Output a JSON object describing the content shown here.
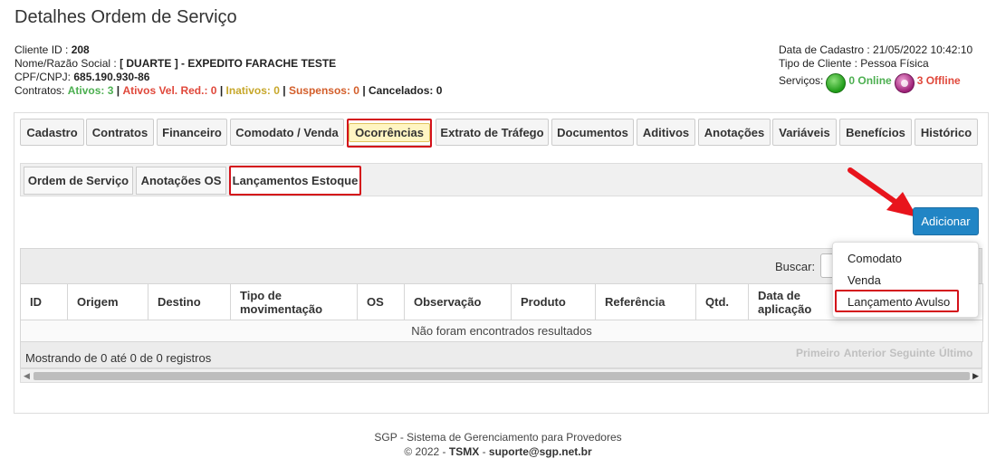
{
  "page": {
    "title": "Detalhes Ordem de Serviço"
  },
  "client": {
    "id_label": "Cliente ID :",
    "id_value": "208",
    "name_label": "Nome/Razão Social :",
    "name_value": "[ DUARTE ] - EXPEDITO FARACHE TESTE",
    "doc_label": "CPF/CNPJ:",
    "doc_value": "685.190.930-86",
    "contracts_label": "Contratos:",
    "contracts": {
      "ativos": "Ativos: 3",
      "ativos_vel": "Ativos Vel. Red.: 0",
      "inativos": "Inativos: 0",
      "suspensos": "Suspensos: 0",
      "cancelados": "Cancelados: 0",
      "sep": "|"
    }
  },
  "meta": {
    "cadastro": "Data de Cadastro : 21/05/2022 10:42:10",
    "tipo": "Tipo de Cliente : Pessoa Física",
    "servicos_label": "Serviços:",
    "online": "0 Online",
    "offline": "3 Offline"
  },
  "tabs": [
    "Cadastro",
    "Contratos",
    "Financeiro",
    "Comodato / Venda",
    "Ocorrências",
    "Extrato de Tráfego",
    "Documentos",
    "Aditivos",
    "Anotações",
    "Variáveis",
    "Benefícios",
    "Histórico"
  ],
  "subtabs": [
    "Ordem de Serviço",
    "Anotações OS",
    "Lançamentos Estoque"
  ],
  "actions": {
    "add": "Adicionar"
  },
  "dropdown": [
    "Comodato",
    "Venda",
    "Lançamento Avulso"
  ],
  "search": {
    "label": "Buscar:"
  },
  "table": {
    "headers": [
      "ID",
      "Origem",
      "Destino",
      "Tipo de movimentação",
      "OS",
      "Observação",
      "Produto",
      "Referência",
      "Qtd.",
      "Data de aplicação"
    ],
    "empty": "Não foram encontrados resultados"
  },
  "pagination": {
    "info": "Mostrando de 0 até 0 de 0 registros",
    "first": "Primeiro",
    "prev": "Anterior",
    "next": "Seguinte",
    "last": "Último"
  },
  "footer": {
    "line1": "SGP - Sistema de Gerenciamento para Provedores",
    "copyright": "© 2022 -",
    "company": "TSMX",
    "dash": "-",
    "email": "suporte@sgp.net.br"
  },
  "colors": {
    "accent": "#2185c5",
    "highlight": "#d4111a",
    "online": "#4caf50",
    "offline": "#e0483b"
  }
}
